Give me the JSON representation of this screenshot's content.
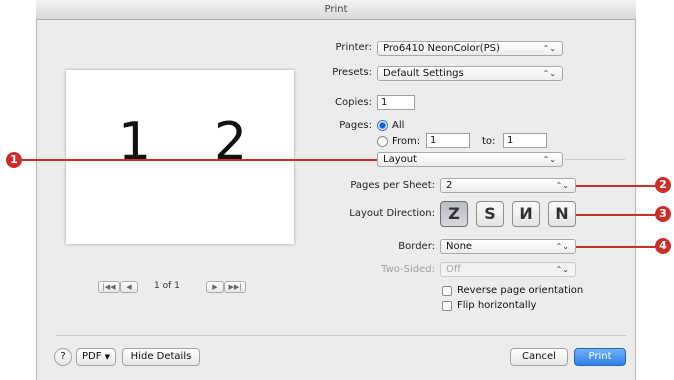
{
  "window": {
    "title": "Print"
  },
  "preview": {
    "page_numbers": [
      "1",
      "2"
    ],
    "pager": "1 of 1",
    "nav_first": "|◀◀",
    "nav_prev": "◀",
    "nav_next": "▶",
    "nav_last": "▶▶|"
  },
  "printer": {
    "label": "Printer:",
    "value": "Pro6410 NeonColor(PS)"
  },
  "presets": {
    "label": "Presets:",
    "value": "Default Settings"
  },
  "copies": {
    "label": "Copies:",
    "value": "1"
  },
  "pages": {
    "label": "Pages:",
    "all": "All",
    "from_label": "From:",
    "from_value": "1",
    "to_label": "to:",
    "to_value": "1",
    "selected": "All"
  },
  "section": {
    "value": "Layout"
  },
  "pages_per_sheet": {
    "label": "Pages per Sheet:",
    "value": "2"
  },
  "layout_direction": {
    "label": "Layout Direction:",
    "options": [
      "Z",
      "S",
      "N",
      "N"
    ],
    "selected_index": 0
  },
  "border": {
    "label": "Border:",
    "value": "None"
  },
  "two_sided": {
    "label": "Two-Sided:",
    "value": "Off",
    "enabled": false
  },
  "options": {
    "reverse": "Reverse page orientation",
    "flip": "Flip horizontally"
  },
  "footer": {
    "help": "?",
    "pdf": "PDF",
    "hide_details": "Hide Details",
    "cancel": "Cancel",
    "print": "Print"
  },
  "callouts": [
    "1",
    "2",
    "3",
    "4"
  ],
  "arrow_glyph": "⌃⌄",
  "colors": {
    "callout": "#c9302c",
    "print_button": "#2f7fe6"
  }
}
